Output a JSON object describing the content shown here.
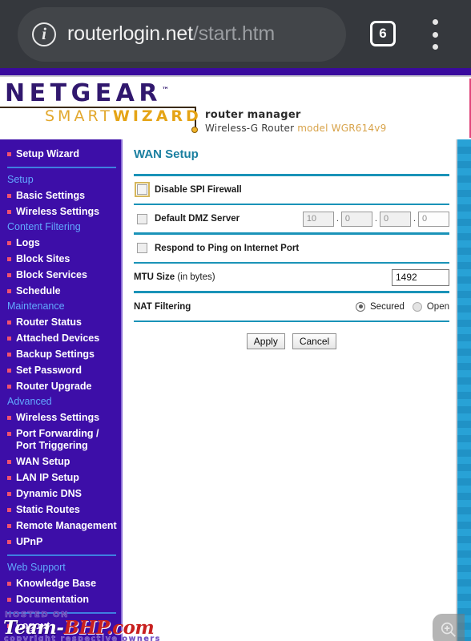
{
  "browser": {
    "site_info_icon": "info-circle-icon",
    "url_domain": "routerlogin.net",
    "url_path": "/start.htm",
    "tab_count": "6",
    "menu_icon": "kebab-menu-icon"
  },
  "brand": {
    "logo_word": "NETGEAR",
    "trademark": "™",
    "wizard_smart": "SMART",
    "wizard_bold": "WIZARD",
    "router_manager": "router manager",
    "device_line": "Wireless-G Router ",
    "device_model": "model WGR614v9"
  },
  "sidebar": {
    "items": [
      {
        "type": "link",
        "label": "Setup Wizard"
      },
      {
        "type": "sep"
      },
      {
        "type": "header",
        "label": "Setup"
      },
      {
        "type": "link",
        "label": "Basic Settings"
      },
      {
        "type": "link",
        "label": "Wireless Settings"
      },
      {
        "type": "header",
        "label": "Content Filtering"
      },
      {
        "type": "link",
        "label": "Logs"
      },
      {
        "type": "link",
        "label": "Block Sites"
      },
      {
        "type": "link",
        "label": "Block Services"
      },
      {
        "type": "link",
        "label": "Schedule"
      },
      {
        "type": "header",
        "label": "Maintenance"
      },
      {
        "type": "link",
        "label": "Router Status"
      },
      {
        "type": "link",
        "label": "Attached Devices"
      },
      {
        "type": "link",
        "label": "Backup Settings"
      },
      {
        "type": "link",
        "label": "Set Password"
      },
      {
        "type": "link",
        "label": "Router Upgrade"
      },
      {
        "type": "header",
        "label": "Advanced"
      },
      {
        "type": "link",
        "label": "Wireless Settings"
      },
      {
        "type": "link",
        "label": "Port Forwarding / Port Triggering"
      },
      {
        "type": "link",
        "label": "WAN Setup"
      },
      {
        "type": "link",
        "label": "LAN IP Setup"
      },
      {
        "type": "link",
        "label": "Dynamic DNS"
      },
      {
        "type": "link",
        "label": "Static Routes"
      },
      {
        "type": "link",
        "label": "Remote Management"
      },
      {
        "type": "link",
        "label": "UPnP"
      },
      {
        "type": "sep"
      },
      {
        "type": "header",
        "label": "Web Support"
      },
      {
        "type": "link",
        "label": "Knowledge Base"
      },
      {
        "type": "link",
        "label": "Documentation"
      },
      {
        "type": "sep"
      },
      {
        "type": "link",
        "label": "Logout"
      }
    ]
  },
  "main": {
    "title": "WAN Setup",
    "spi": {
      "label": "Disable SPI Firewall",
      "checked": false
    },
    "dmz": {
      "label": "Default DMZ Server",
      "checked": false,
      "octets": [
        "10",
        "0",
        "0",
        "0"
      ],
      "separator": "."
    },
    "ping": {
      "label": "Respond to Ping on Internet Port",
      "checked": false
    },
    "mtu": {
      "label_bold": "MTU Size ",
      "label_thin": "(in bytes)",
      "value": "1492"
    },
    "nat": {
      "label": "NAT Filtering",
      "options": [
        {
          "label": "Secured",
          "selected": true
        },
        {
          "label": "Open",
          "selected": false
        }
      ]
    },
    "buttons": {
      "apply": "Apply",
      "cancel": "Cancel"
    }
  },
  "watermark": {
    "hosted_on": "HOSTED ON",
    "brand_white": "Team-",
    "brand_red": "BHP.com",
    "copyright": "copyright respective owners"
  },
  "fab": {
    "icon": "zoom-in-icon"
  },
  "colors": {
    "sidebar_bg": "#3d0ea8",
    "nav_header": "#62a9ff",
    "bullet": "#f0516f",
    "rule": "#1a93b8",
    "title": "#1a7fa0",
    "netgear_purple": "#31186e",
    "wizard_gold": "#e2a72c",
    "browser_bg": "#35383d"
  }
}
